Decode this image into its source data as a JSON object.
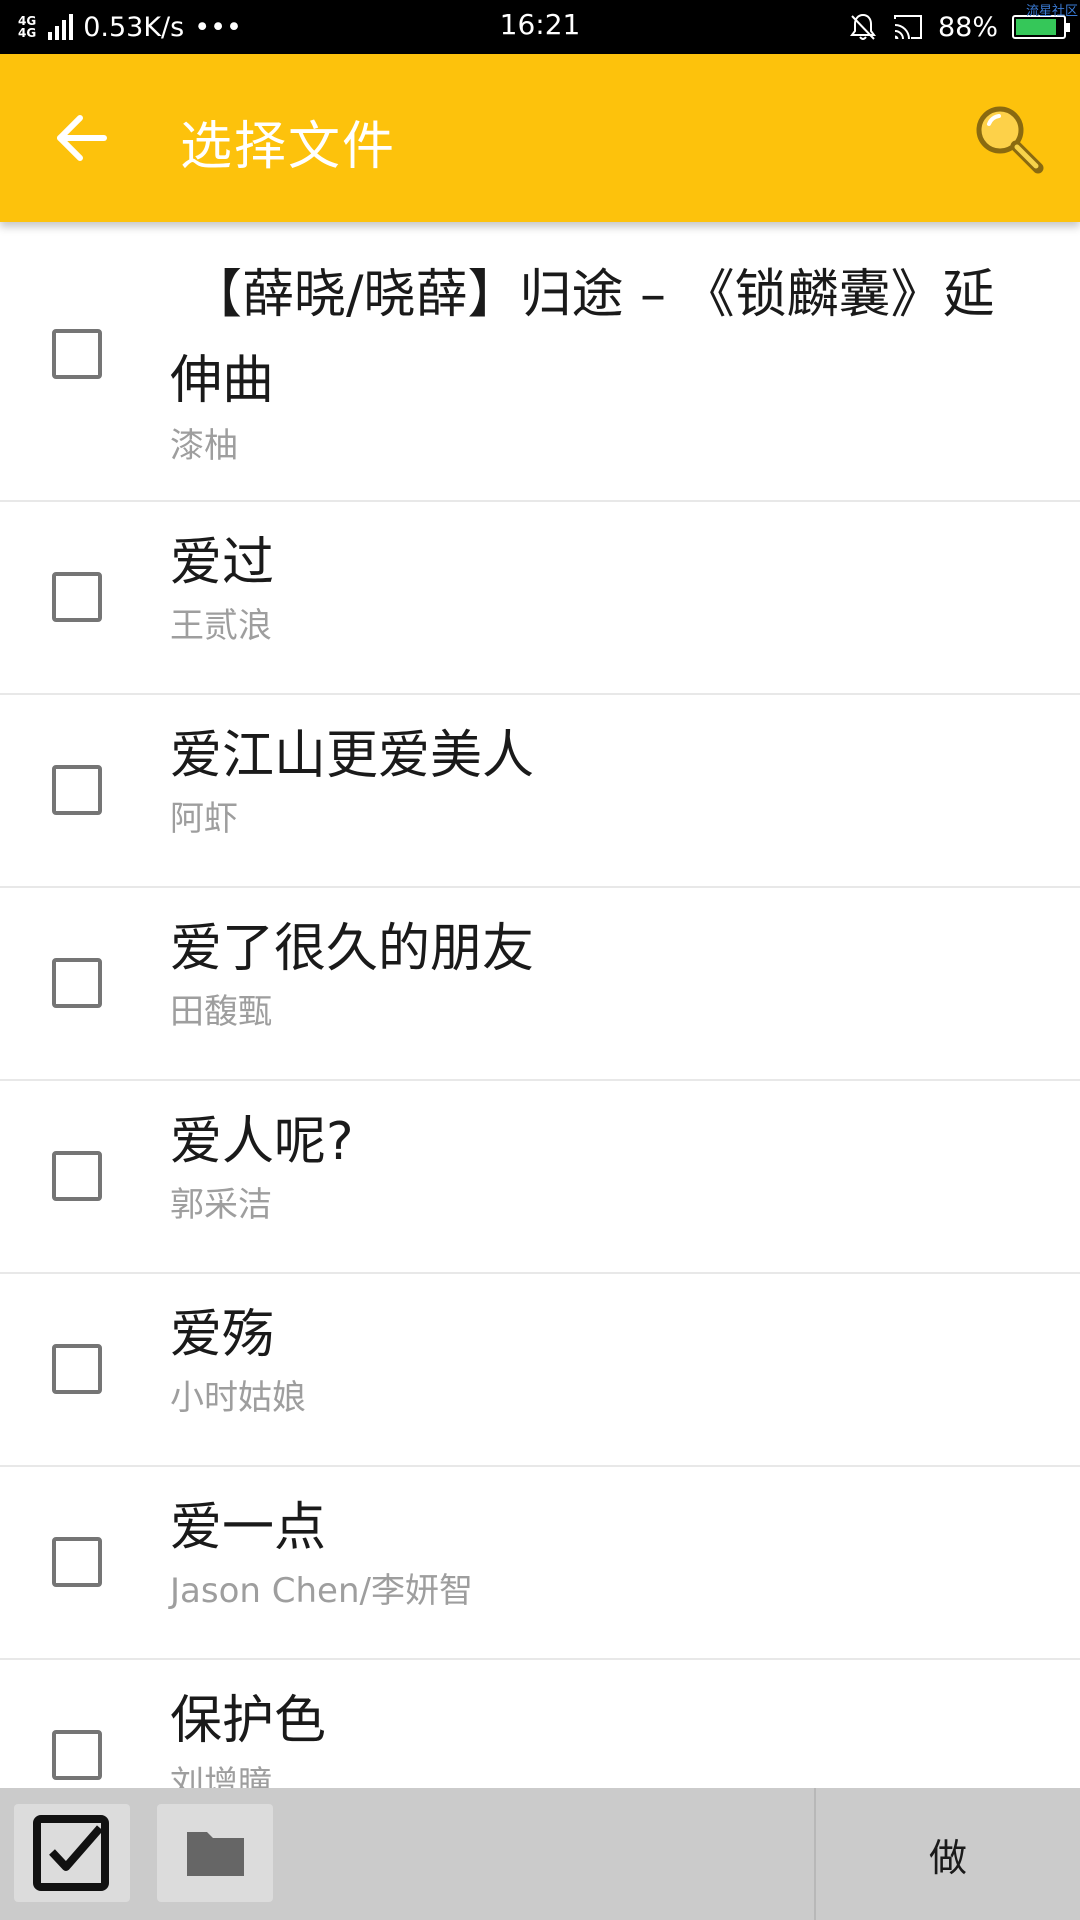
{
  "status_bar": {
    "network_top": "4G",
    "network_bottom": "4G",
    "speed": "0.53K/s",
    "more": "•••",
    "time": "16:21",
    "battery_percent_text": "88%",
    "battery_level": 0.88,
    "watermark": "流星社区"
  },
  "app_bar": {
    "title": "选择文件",
    "back_icon": "arrow-back-icon",
    "search_icon": "search-icon",
    "color": "#fdc20c"
  },
  "songs": [
    {
      "title": "【薛晓/晓薛】归途 – 《锁麟囊》延伸曲",
      "artist": "漆柚",
      "checked": false
    },
    {
      "title": "爱过",
      "artist": "王贰浪",
      "checked": false
    },
    {
      "title": "爱江山更爱美人",
      "artist": "阿虾",
      "checked": false
    },
    {
      "title": "爱了很久的朋友",
      "artist": "田馥甄",
      "checked": false
    },
    {
      "title": "爱人呢?",
      "artist": "郭采洁",
      "checked": false
    },
    {
      "title": "爱殇",
      "artist": "小时姑娘",
      "checked": false
    },
    {
      "title": "爱一点",
      "artist": "Jason Chen/李妍智",
      "checked": false
    },
    {
      "title": "保护色",
      "artist": "刘增瞳",
      "checked": false
    }
  ],
  "bottom_bar": {
    "select_all_icon": "checkbox-checked-icon",
    "folder_icon": "folder-icon",
    "action_label": "做"
  }
}
